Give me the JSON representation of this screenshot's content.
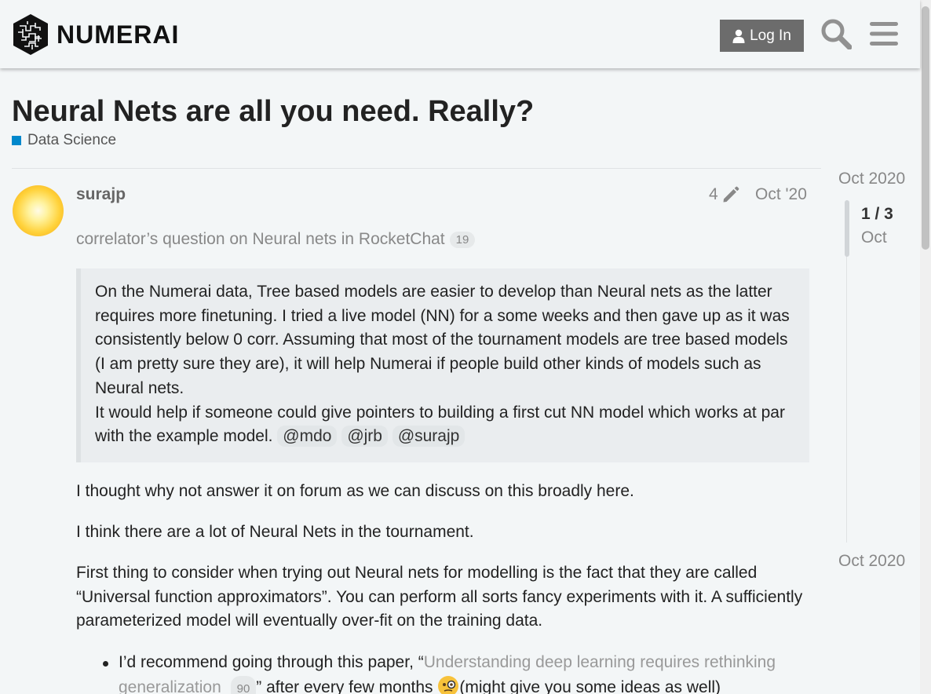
{
  "header": {
    "brand": "NUMERAI",
    "login_label": "Log In"
  },
  "topic": {
    "title": "Neural Nets are all you need. Really?",
    "category": "Data Science",
    "category_color": "#0088cc"
  },
  "post": {
    "username": "surajp",
    "edit_count": "4",
    "date": "Oct '20",
    "linkback_text": "correlator’s question on Neural nets in RocketChat",
    "linkback_count": "19",
    "quote": {
      "text": "On the Numerai data, Tree based models are easier to develop than Neural nets as the latter requires more finetuning. I tried a live model (NN) for a some weeks and then gave up as it was consistently below 0 corr. Assuming that most of the tournament models are tree based models (I am pretty sure they are), it will help Numerai if people build other kinds of models such as Neural nets.",
      "text2": "It would help if someone could give pointers to building a first cut NN model which works at par with the example model. ",
      "mentions": [
        "@mdo",
        "@jrb",
        "@surajp"
      ]
    },
    "paragraphs": [
      "I thought why not answer it on forum as we can discuss on this broadly here.",
      "I think there are a lot of Neural Nets in the tournament.",
      "First thing to consider when trying out Neural nets for modelling is the fact that they are called “Universal function approximators”. You can perform all sorts fancy experiments with it. A sufficiently parameterized model will eventually over-fit on the training data."
    ],
    "bullet": {
      "prefix": "I’d recommend going through this paper, “",
      "link_text": "Understanding deep learning requires rethinking generalization",
      "link_count": "90",
      "middle": "” after every few months ",
      "suffix": "(might give you some ideas as well)"
    }
  },
  "timeline": {
    "start_date": "Oct 2020",
    "counter": "1 / 3",
    "sub": "Oct",
    "end_date": "Oct 2020"
  }
}
